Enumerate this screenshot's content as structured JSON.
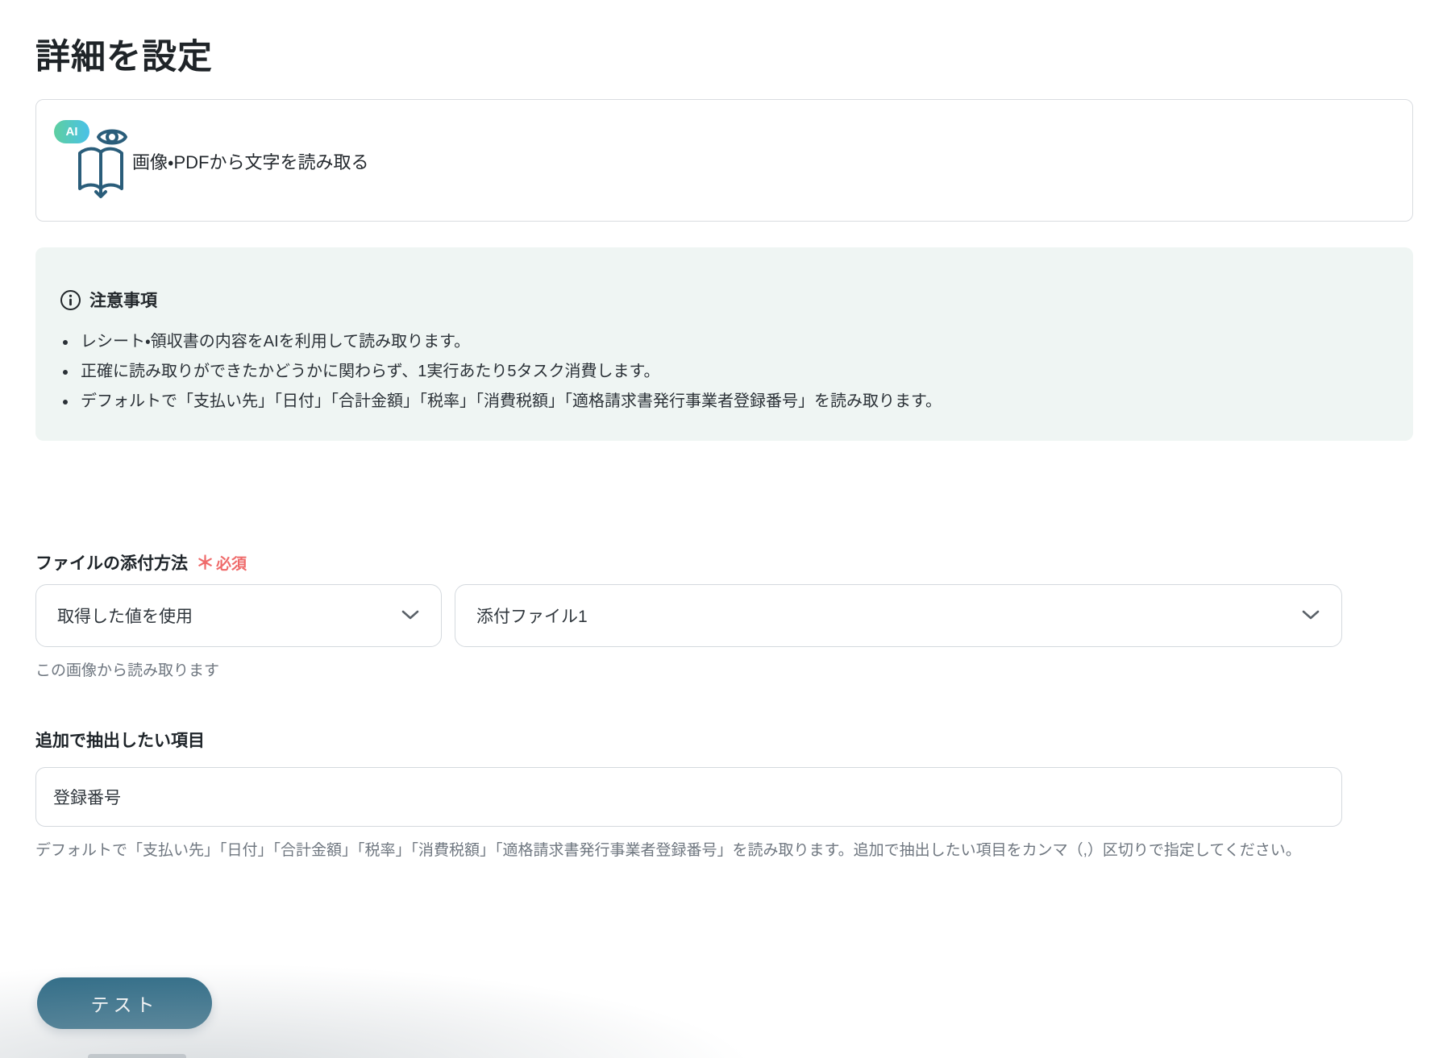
{
  "page": {
    "title": "詳細を設定"
  },
  "action_card": {
    "badge": "AI",
    "label": "画像・PDFから文字を読み取る"
  },
  "notice": {
    "title": "注意事項",
    "items": [
      "レシート・領収書の内容をAIを利用して読み取ります。",
      "正確に読み取りができたかどうかに関わらず、1実行あたり5タスク消費します。",
      "デフォルトで「支払い先」「日付」「合計金額」「税率」「消費税額」「適格請求書発行事業者登録番号」を読み取ります。"
    ]
  },
  "attachment_section": {
    "label": "ファイルの添付方法",
    "required_mark": "＊",
    "required_text": "必須",
    "method_select_value": "取得した値を使用",
    "file_select_value": "添付ファイル1",
    "helper": "この画像から読み取ります"
  },
  "extra_items_section": {
    "label": "追加で抽出したい項目",
    "input_value": "登録番号",
    "helper": "デフォルトで「支払い先」「日付」「合計金額」「税率」「消費税額」「適格請求書発行事業者登録番号」を読み取ります。追加で抽出したい項目をカンマ（,）区切りで指定してください。"
  },
  "footer": {
    "test_button_label": "テスト"
  },
  "colors": {
    "accent_button": "#2e6b86",
    "badge_gradient_start": "#5ecfa0",
    "badge_gradient_end": "#49c1e8",
    "notice_background": "#eff5f3",
    "required_red": "#ef6b6b",
    "icon_stroke": "#2a5d7a",
    "border_gray": "#d4d9de",
    "helper_gray": "#6f7780",
    "text_dark": "#23282d"
  }
}
